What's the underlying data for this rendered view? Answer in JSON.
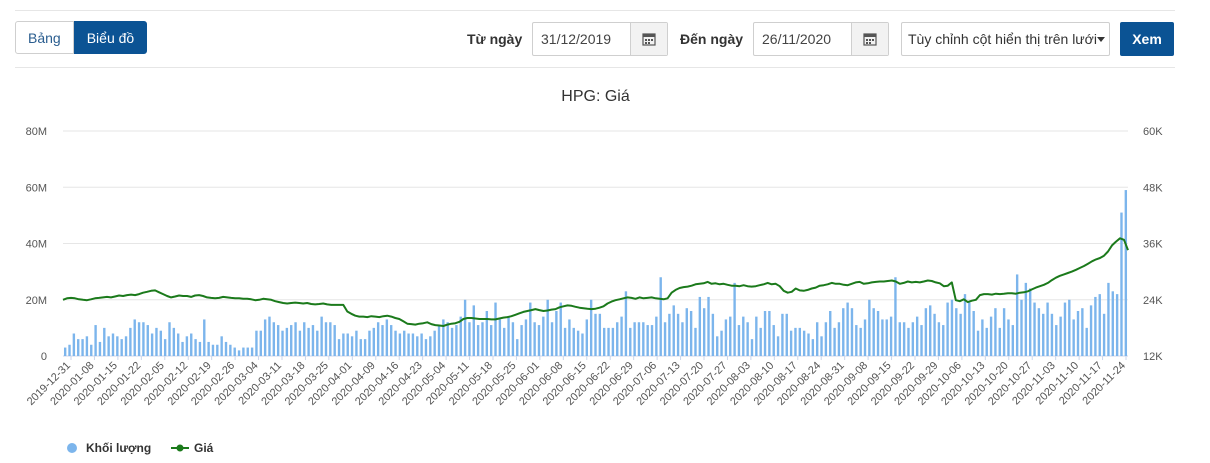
{
  "toolbar": {
    "tab_table": "Bảng",
    "tab_chart": "Biểu đồ",
    "from_label": "Từ ngày",
    "from_value": "31/12/2019",
    "to_label": "Đến ngày",
    "to_value": "26/11/2020",
    "column_select": "Tùy chỉnh cột hiển thị trên lưới",
    "view_button": "Xem"
  },
  "chart_data": {
    "type": "bar+line",
    "title": "HPG: Giá",
    "y_left": {
      "ticks": [
        "0",
        "20M",
        "40M",
        "60M",
        "80M"
      ],
      "range": [
        0,
        80
      ]
    },
    "y_right": {
      "ticks": [
        "12K",
        "24K",
        "36K",
        "48K",
        "60K"
      ],
      "range": [
        12,
        60
      ]
    },
    "x_ticks": [
      "2019-12-31",
      "2020-01-08",
      "2020-01-15",
      "2020-01-22",
      "2020-02-05",
      "2020-02-12",
      "2020-02-19",
      "2020-02-26",
      "2020-03-04",
      "2020-03-11",
      "2020-03-18",
      "2020-03-25",
      "2020-04-01",
      "2020-04-09",
      "2020-04-16",
      "2020-04-23",
      "2020-05-04",
      "2020-05-11",
      "2020-05-18",
      "2020-05-25",
      "2020-06-01",
      "2020-06-08",
      "2020-06-15",
      "2020-06-22",
      "2020-06-29",
      "2020-07-06",
      "2020-07-13",
      "2020-07-20",
      "2020-07-27",
      "2020-08-03",
      "2020-08-10",
      "2020-08-17",
      "2020-08-24",
      "2020-08-31",
      "2020-09-08",
      "2020-09-15",
      "2020-09-22",
      "2020-09-29",
      "2020-10-06",
      "2020-10-13",
      "2020-10-20",
      "2020-10-27",
      "2020-11-03",
      "2020-11-10",
      "2020-11-17",
      "2020-11-24"
    ],
    "volume_millions": [
      3,
      4,
      8,
      6,
      6,
      7,
      4,
      11,
      5,
      10,
      7,
      8,
      7,
      6,
      7,
      10,
      13,
      12,
      12,
      11,
      8,
      10,
      9,
      6,
      12,
      10,
      8,
      5,
      7,
      8,
      6,
      5,
      13,
      5,
      4,
      4,
      7,
      5,
      4,
      3,
      2,
      3,
      3,
      3,
      9,
      9,
      13,
      14,
      12,
      11,
      9,
      10,
      11,
      12,
      9,
      12,
      10,
      11,
      9,
      14,
      12,
      12,
      11,
      6,
      8,
      8,
      7,
      9,
      6,
      6,
      9,
      10,
      12,
      11,
      13,
      11,
      9,
      8,
      9,
      8,
      8,
      7,
      8,
      6,
      7,
      9,
      11,
      13,
      12,
      10,
      11,
      14,
      20,
      12,
      18,
      11,
      12,
      16,
      11,
      19,
      13,
      10,
      14,
      12,
      6,
      11,
      13,
      19,
      12,
      11,
      14,
      20,
      12,
      16,
      19,
      10,
      13,
      10,
      9,
      8,
      13,
      20,
      15,
      15,
      10,
      10,
      10,
      12,
      14,
      23,
      10,
      12,
      12,
      12,
      11,
      11,
      14,
      28,
      12,
      15,
      18,
      15,
      12,
      17,
      16,
      10,
      21,
      17,
      21,
      15,
      7,
      9,
      13,
      14,
      26,
      11,
      14,
      12,
      6,
      14,
      10,
      16,
      16,
      11,
      7,
      15,
      15,
      9,
      10,
      10,
      9,
      8,
      6,
      12,
      7,
      12,
      16,
      10,
      12,
      17,
      19,
      17,
      11,
      10,
      13,
      20,
      17,
      16,
      13,
      13,
      14,
      28,
      12,
      12,
      10,
      12,
      14,
      11,
      17,
      18,
      15,
      12,
      11,
      19,
      20,
      17,
      15,
      22,
      19,
      16,
      9,
      13,
      10,
      14,
      17,
      10,
      17,
      13,
      11,
      29,
      20,
      26,
      24,
      19,
      17,
      15,
      19,
      15,
      11,
      14,
      19,
      20,
      13,
      16,
      17,
      10,
      18,
      21,
      22,
      15,
      26,
      23,
      22,
      51,
      59
    ],
    "price_thousands": [
      24.0,
      24.3,
      24.4,
      24.3,
      24.1,
      24.0,
      23.9,
      24.1,
      24.3,
      24.4,
      24.5,
      24.6,
      24.5,
      24.7,
      24.9,
      24.8,
      25.0,
      25.1,
      25.0,
      25.2,
      25.5,
      25.7,
      25.9,
      26.0,
      25.6,
      25.2,
      24.8,
      24.5,
      24.7,
      24.9,
      24.8,
      24.8,
      24.6,
      24.9,
      25.0,
      24.8,
      24.5,
      24.4,
      24.3,
      24.4,
      24.6,
      24.5,
      24.4,
      24.3,
      24.3,
      24.2,
      24.2,
      24.1,
      23.9,
      24.0,
      24.2,
      24.1,
      24.0,
      23.7,
      23.5,
      23.3,
      23.2,
      23.3,
      23.4,
      23.3,
      23.2,
      23.3,
      23.1,
      23.0,
      23.1,
      23.2,
      23.0,
      22.9,
      22.9,
      22.9,
      22.9,
      21.5,
      21.0,
      20.6,
      20.4,
      20.4,
      20.3,
      20.5,
      20.4,
      20.3,
      20.5,
      20.6,
      20.4,
      20.1,
      19.9,
      19.4,
      18.9,
      18.8,
      18.7,
      18.9,
      19.0,
      19.2,
      18.8,
      18.6,
      18.5,
      18.4,
      18.7,
      18.9,
      19.0,
      19.3,
      19.9,
      20.1,
      20.1,
      20.0,
      19.9,
      19.9,
      19.9,
      19.8,
      19.8,
      20.0,
      20.2,
      20.3,
      20.5,
      20.8,
      21.1,
      21.4,
      21.6,
      21.8,
      22.0,
      21.8,
      21.6,
      21.7,
      21.9,
      22.0,
      22.4,
      22.6,
      22.8,
      22.7,
      22.5,
      22.3,
      22.2,
      22.1,
      22.0,
      22.1,
      22.3,
      22.6,
      23.2,
      23.6,
      23.9,
      24.1,
      24.3,
      24.5,
      24.4,
      24.2,
      24.5,
      24.3,
      24.4,
      24.5,
      24.3,
      24.2,
      24.1,
      24.3,
      25.5,
      26.1,
      26.5,
      26.7,
      26.8,
      27.0,
      27.3,
      27.4,
      27.5,
      27.8,
      27.4,
      27.5,
      27.3,
      27.4,
      27.2,
      27.0,
      27.0,
      26.9,
      27.1,
      26.9,
      26.8,
      26.9,
      27.1,
      27.3,
      27.6,
      27.3,
      27.4,
      26.9,
      25.9,
      25.5,
      25.7,
      26.4,
      26.0,
      25.9,
      26.1,
      26.4,
      26.6,
      27.0,
      27.1,
      27.3,
      27.6,
      27.4,
      27.4,
      27.2,
      27.1,
      27.4,
      27.7,
      27.8,
      27.4,
      27.5,
      27.7,
      27.8,
      27.9,
      27.9,
      28.0,
      28.1,
      27.9,
      27.4,
      27.6,
      27.9,
      27.7,
      27.8,
      27.7,
      27.9,
      28.1,
      28.0,
      27.7,
      27.5,
      26.9,
      27.0,
      27.7,
      23.9,
      23.7,
      24.1,
      23.5,
      23.8,
      24.0,
      25.0,
      25.2,
      25.2,
      25.1,
      25.3,
      25.2,
      25.3,
      25.4,
      25.4,
      25.3,
      25.5,
      25.6,
      25.8,
      26.2,
      26.6,
      26.9,
      27.2,
      27.6,
      28.2,
      28.7,
      29.1,
      29.4,
      29.7,
      30.0,
      30.4,
      30.8,
      31.2,
      31.7,
      32.2,
      32.6,
      32.9,
      33.4,
      34.3,
      35.6,
      36.4,
      37.1,
      36.8,
      34.6
    ]
  },
  "legend": {
    "volume": "Khối lượng",
    "price": "Giá"
  },
  "colors": {
    "bar": "#7cb5ec",
    "line": "#1b7a1b",
    "accent": "#0b5394"
  }
}
